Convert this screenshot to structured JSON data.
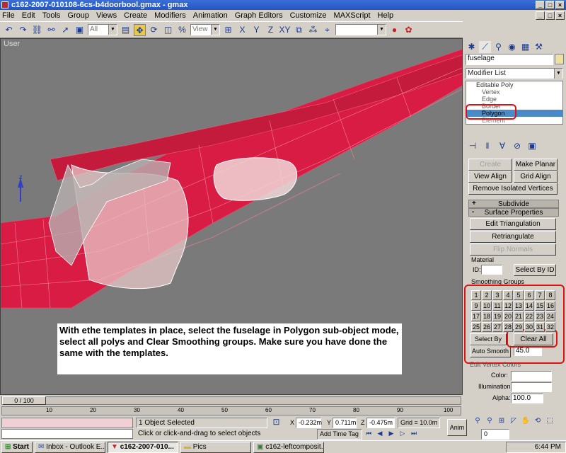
{
  "window": {
    "title": "c162-2007-010108-6cs-b4doorbool.gmax - gmax"
  },
  "menu": [
    "File",
    "Edit",
    "Tools",
    "Group",
    "Views",
    "Create",
    "Modifiers",
    "Animation",
    "Graph Editors",
    "Customize",
    "MAXScript",
    "Help"
  ],
  "toolbar": {
    "selection_filter": "All",
    "reference_coord": "View"
  },
  "viewport": {
    "label": "User",
    "annotation": "With ethe templates in place, select the fuselage in Polygon sub-object mode, select all polys and Clear Smoothing groups.  Make sure you have done the same with the templates."
  },
  "command_panel": {
    "object_name": "fuselage",
    "modifier_list": "Modifier List",
    "stack": [
      "Editable Poly",
      "Vertex",
      "Edge",
      "Border",
      "Polygon",
      "Element"
    ],
    "selected_stack_item": "Polygon",
    "buttons": {
      "create_shape": "Create Shape",
      "make_planar": "Make Planar",
      "view_align": "View Align",
      "grid_align": "Grid Align",
      "remove_isolated": "Remove Isolated Vertices",
      "edit_triangulation": "Edit Triangulation",
      "retriangulate": "Retriangulate",
      "flip_normals": "Flip Normals",
      "select_by_id": "Select By ID",
      "select_by_sg": "Select By SG",
      "clear_all": "Clear All",
      "auto_smooth": "Auto Smooth"
    },
    "rollouts": {
      "subdivide": "Subdivide",
      "surface_properties": "Surface Properties"
    },
    "material_label": "Material",
    "id_label": "ID:",
    "smoothing_groups_label": "Smoothing Groups",
    "smoothing_groups": [
      "1",
      "2",
      "3",
      "4",
      "5",
      "6",
      "7",
      "8",
      "9",
      "10",
      "11",
      "12",
      "13",
      "14",
      "15",
      "16",
      "17",
      "18",
      "19",
      "20",
      "21",
      "22",
      "23",
      "24",
      "25",
      "26",
      "27",
      "28",
      "29",
      "30",
      "31",
      "32"
    ],
    "auto_smooth_value": "45.0",
    "vertex_colors_label": "Edit Vertex Colors",
    "color_label": "Color:",
    "illumination_label": "Illumination:",
    "alpha_label": "Alpha:",
    "alpha_value": "100.0"
  },
  "timeline": {
    "slider_text": "0 / 100",
    "ticks": [
      "10",
      "20",
      "30",
      "40",
      "50",
      "60",
      "70",
      "80",
      "90",
      "100"
    ]
  },
  "status": {
    "objects_selected": "1 Object Selected",
    "prompt": "Click or click-and-drag to select objects",
    "x_value": "-0.232m",
    "y_value": "0.711m",
    "z_value": "-0.475m",
    "grid": "Grid = 10.0m",
    "add_time_tag": "Add Time Tag",
    "anim_label": "Anim",
    "frame_value": "0"
  },
  "taskbar": {
    "start": "Start",
    "items": [
      "Inbox - Outlook E...",
      "c162-2007-010...",
      "Pics",
      "c162-leftcomposit..."
    ],
    "active_index": 1,
    "clock": "6:44 PM"
  },
  "colors": {
    "titlebar": "#2455c3",
    "fuselage": "#d81c44",
    "viewport_bg": "#7a7a7a",
    "highlight_box": "#e01010",
    "stack_selected": "#4a8ac8"
  }
}
